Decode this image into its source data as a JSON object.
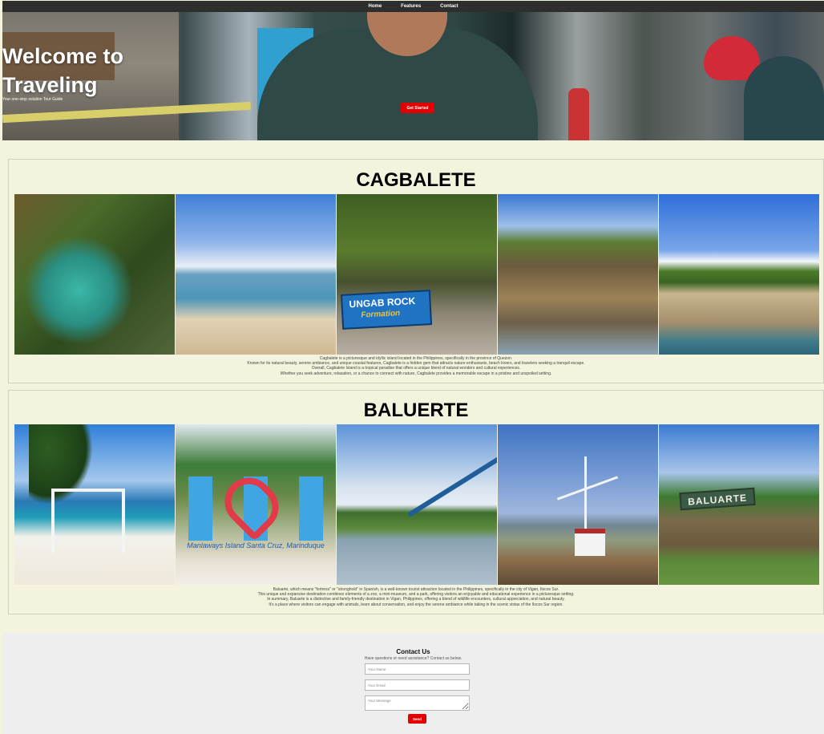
{
  "nav": {
    "items": [
      {
        "label": "Home"
      },
      {
        "label": "Features"
      },
      {
        "label": "Contact"
      }
    ]
  },
  "hero": {
    "title_line1": "Welcome to",
    "title_line2": "Traveling",
    "subtitle": "Your one-stop solution Tour Guide",
    "cta_label": "Get Started"
  },
  "destinations": [
    {
      "title": "CAGBALETE",
      "photos": [
        "lagoon-photo",
        "beach-photo",
        "rock-formation-photo",
        "rock-arch-photo",
        "cliffs-photo"
      ],
      "sign_text": "UNGAB ROCK",
      "sign_sub": "Formation",
      "description": [
        "Cagbalete is a picturesque and idyllic island located in the Philippines, specifically in the province of Quezon.",
        "Known for its natural beauty, serene ambiance, and unique coastal features, Cagbalete is a hidden gem that attracts nature enthusiasts, beach lovers, and travelers seeking a tranquil escape.",
        "Overall, Cagbalete Island is a tropical paradise that offers a unique blend of natural wonders and cultural experiences.",
        "Whether you seek adventure, relaxation, or a chance to connect with nature, Cagbalete provides a memorable escape in a pristine and unspoiled setting."
      ]
    },
    {
      "title": "BALUERTE",
      "photos": [
        "beach-swing-photo",
        "i-love-sign-photo",
        "sea-island-photo",
        "windmill-photo",
        "baluarte-sign-photo"
      ],
      "love_sign_text": "Manlaways Island Santa Cruz, Marinduque",
      "baluarte_sign": "BALUARTE",
      "description": [
        "Baluarte, which means \"fortress\" or \"stronghold\" in Spanish, is a well-known tourist attraction located in the Philippines, specifically in the city of Vigan, Ilocos Sur.",
        "This unique and expansive destination combines elements of a zoo, a mini-museum, and a park, offering visitors an enjoyable and educational experience in a picturesque setting.",
        "In summary, Baluarte is a distinctive and family-friendly destination in Vigan, Philippines, offering a blend of wildlife encounters, cultural appreciation, and natural beauty.",
        "It's a place where visitors can engage with animals, learn about conservation, and enjoy the serene ambiance while taking in the scenic vistas of the Ilocos Sur region."
      ]
    }
  ],
  "contact": {
    "title": "Contact Us",
    "lead": "Have questions or need assistance? Contact us below.",
    "name_placeholder": "Your Name",
    "email_placeholder": "Your Email",
    "message_placeholder": "Your Message",
    "send_label": "Send"
  },
  "colors": {
    "nav_bg": "#2e2e2e",
    "page_bg": "#f4f3dd",
    "accent_red": "#e30000",
    "contact_bg": "#eeeeee"
  }
}
